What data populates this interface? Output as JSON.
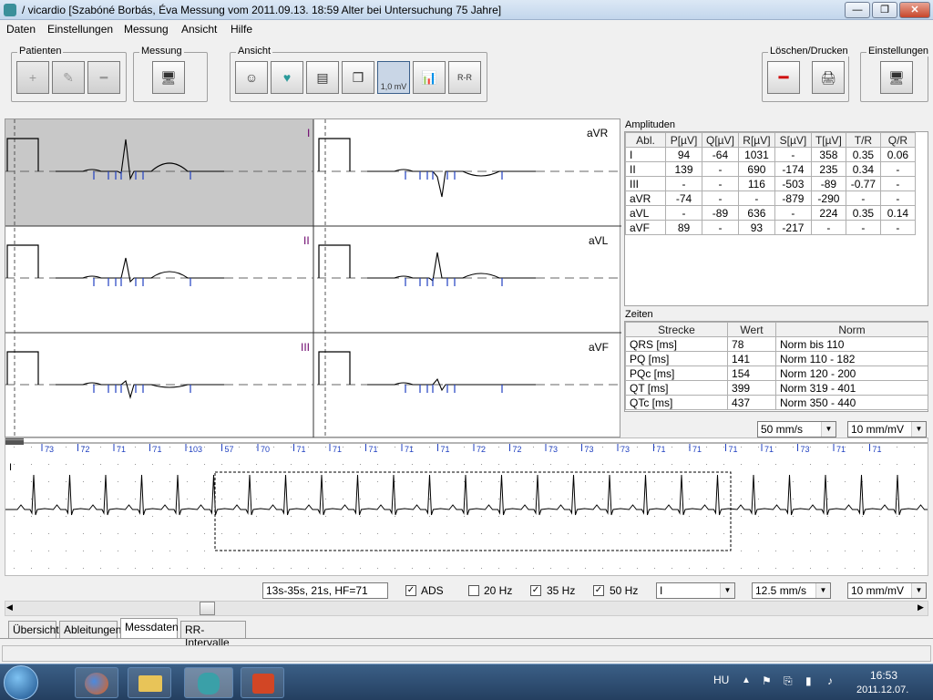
{
  "window": {
    "title": "/ vicardio [Szabóné Borbás, Éva Messung vom 2011.09.13. 18:59 Alter bei Untersuchung 75 Jahre]",
    "min": "—",
    "max": "❐",
    "close": "✕"
  },
  "menu": [
    "Daten",
    "Einstellungen",
    "Messung",
    "Ansicht",
    "Hilfe"
  ],
  "toolbar": {
    "patienten": "Patienten",
    "messung": "Messung",
    "ansicht": "Ansicht",
    "loeschen": "Löschen/Drucken",
    "einstellungen": "Einstellungen",
    "mv_label": "1,0 mV",
    "rr_label": "R-R"
  },
  "leads": {
    "left": [
      "I",
      "II",
      "III"
    ],
    "right": [
      "aVR",
      "aVL",
      "aVF"
    ]
  },
  "amplituden": {
    "title": "Amplituden",
    "headers": [
      "Abl.",
      "P[µV]",
      "Q[µV]",
      "R[µV]",
      "S[µV]",
      "T[µV]",
      "T/R",
      "Q/R"
    ],
    "rows": [
      [
        "I",
        "94",
        "-64",
        "1031",
        "-",
        "358",
        "0.35",
        "0.06"
      ],
      [
        "II",
        "139",
        "-",
        "690",
        "-174",
        "235",
        "0.34",
        "-"
      ],
      [
        "III",
        "-",
        "-",
        "116",
        "-503",
        "-89",
        "-0.77",
        "-"
      ],
      [
        "aVR",
        "-74",
        "-",
        "-",
        "-879",
        "-290",
        "-",
        "-"
      ],
      [
        "aVL",
        "-",
        "-89",
        "636",
        "-",
        "224",
        "0.35",
        "0.14"
      ],
      [
        "aVF",
        "89",
        "-",
        "93",
        "-217",
        "-",
        "-",
        "-"
      ]
    ]
  },
  "zeiten": {
    "title": "Zeiten",
    "headers": [
      "Strecke",
      "Wert",
      "Norm"
    ],
    "rows": [
      [
        "QRS [ms]",
        "78",
        "Norm bis 110"
      ],
      [
        "PQ [ms]",
        "141",
        "Norm 110 - 182"
      ],
      [
        "PQc [ms]",
        "154",
        "Norm 120 - 200"
      ],
      [
        "QT [ms]",
        "399",
        "Norm 319 - 401"
      ],
      [
        "QTc [ms]",
        "437",
        "Norm 350 - 440"
      ]
    ]
  },
  "speed_top": "50 mm/s",
  "gain_top": "10 mm/mV",
  "rr_values": [
    "73",
    "72",
    "71",
    "71",
    "103",
    "57",
    "70",
    "71",
    "71",
    "71",
    "71",
    "71",
    "72",
    "72",
    "73",
    "73",
    "73",
    "71",
    "71",
    "71",
    "71",
    "73",
    "71",
    "71"
  ],
  "rhythm_lead": "I",
  "status": {
    "info": "13s-35s, 21s, HF=71",
    "ads": "ADS",
    "hz20": "20 Hz",
    "hz35": "35 Hz",
    "hz50": "50 Hz",
    "lead": "I",
    "speed": "12.5 mm/s",
    "gain": "10 mm/mV"
  },
  "tabs": [
    "Übersicht",
    "Ableitungen",
    "Messdaten",
    "RR-Intervalle"
  ],
  "taskbar": {
    "lang": "HU",
    "time": "16:53",
    "date": "2011.12.07."
  }
}
